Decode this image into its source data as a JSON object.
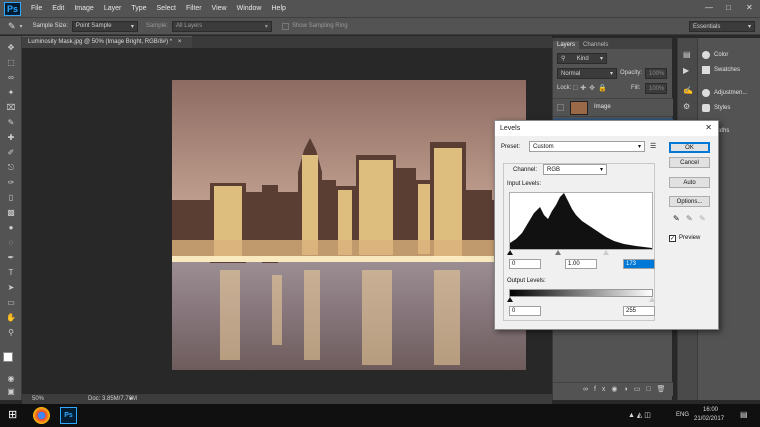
{
  "menubar": {
    "logo": "Ps",
    "items": [
      "File",
      "Edit",
      "Image",
      "Layer",
      "Type",
      "Select",
      "Filter",
      "View",
      "Window",
      "Help"
    ]
  },
  "optionsbar": {
    "sample_size_label": "Sample Size:",
    "sample_size_value": "Point Sample",
    "sample_label": "Sample:",
    "sample_value": "All Layers",
    "sampling_ring_label": "Show Sampling Ring",
    "workspace": "Essentials"
  },
  "document": {
    "tab_title": "Luminosity Mask.jpg @ 50% (Image Bright, RGB/8#) *",
    "zoom": "50%",
    "doc_info": "Doc: 3.85M/7.70M"
  },
  "layers_panel": {
    "tabs": [
      "Layers",
      "Channels"
    ],
    "kind_label": "Kind",
    "blend_mode": "Normal",
    "opacity_label": "Opacity:",
    "opacity_value": "100%",
    "lock_label": "Lock:",
    "fill_label": "Fill:",
    "fill_value": "100%",
    "layer_name": "Image"
  },
  "right_panel": {
    "items": [
      "Color",
      "Swatches",
      "Adjustmen...",
      "Styles",
      "Paths"
    ]
  },
  "levels_dialog": {
    "title": "Levels",
    "preset_label": "Preset:",
    "preset_value": "Custom",
    "channel_label": "Channel:",
    "channel_value": "RGB",
    "input_levels_label": "Input Levels:",
    "input_black": "0",
    "input_gamma": "1.00",
    "input_white": "173",
    "output_levels_label": "Output Levels:",
    "output_black": "0",
    "output_white": "255",
    "ok_label": "OK",
    "cancel_label": "Cancel",
    "auto_label": "Auto",
    "options_label": "Options...",
    "preview_label": "Preview",
    "preview_checked": true
  },
  "taskbar": {
    "language": "ENG",
    "time": "16:00",
    "date": "21/02/2017"
  },
  "colors": {
    "accent": "#0078d7",
    "ps_ui": "#535353",
    "canvas_bg": "#282828"
  }
}
